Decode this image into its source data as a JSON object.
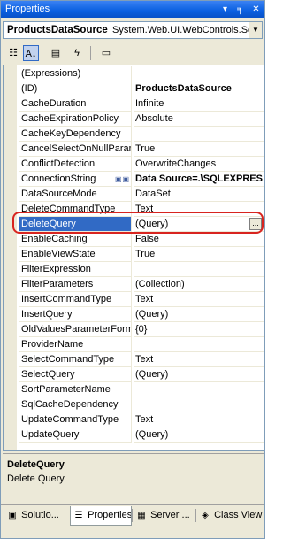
{
  "window": {
    "title": "Properties",
    "dropdown_glyph": "▾",
    "pin_glyph": "╕",
    "close_glyph": "✕"
  },
  "object_selector": {
    "name": "ProductsDataSource",
    "type": "System.Web.UI.WebControls.Sq"
  },
  "toolbar": {
    "buttons": [
      {
        "icon": "categorized-icon",
        "glyph": "☷"
      },
      {
        "icon": "alphabetical-icon",
        "glyph": "A↓"
      },
      {
        "icon": "properties-icon",
        "glyph": "▤"
      },
      {
        "icon": "events-icon",
        "glyph": "ϟ"
      },
      {
        "icon": "property-pages-icon",
        "glyph": "▭"
      }
    ]
  },
  "properties": [
    {
      "name": "(Expressions)",
      "value": ""
    },
    {
      "name": "(ID)",
      "value": "ProductsDataSource"
    },
    {
      "name": "CacheDuration",
      "value": "Infinite"
    },
    {
      "name": "CacheExpirationPolicy",
      "value": "Absolute"
    },
    {
      "name": "CacheKeyDependency",
      "value": ""
    },
    {
      "name": "CancelSelectOnNullParame",
      "value": "True"
    },
    {
      "name": "ConflictDetection",
      "value": "OverwriteChanges"
    },
    {
      "name": "ConnectionString",
      "value": "Data Source=.\\SQLEXPRES"
    },
    {
      "name": "DataSourceMode",
      "value": "DataSet"
    },
    {
      "name": "DeleteCommandType",
      "value": "Text"
    },
    {
      "name": "DeleteQuery",
      "value": "(Query)"
    },
    {
      "name": "EnableCaching",
      "value": "False"
    },
    {
      "name": "EnableViewState",
      "value": "True"
    },
    {
      "name": "FilterExpression",
      "value": ""
    },
    {
      "name": "FilterParameters",
      "value": "(Collection)"
    },
    {
      "name": "InsertCommandType",
      "value": "Text"
    },
    {
      "name": "InsertQuery",
      "value": "(Query)"
    },
    {
      "name": "OldValuesParameterForma",
      "value": "{0}"
    },
    {
      "name": "ProviderName",
      "value": ""
    },
    {
      "name": "SelectCommandType",
      "value": "Text"
    },
    {
      "name": "SelectQuery",
      "value": "(Query)"
    },
    {
      "name": "SortParameterName",
      "value": ""
    },
    {
      "name": "SqlCacheDependency",
      "value": ""
    },
    {
      "name": "UpdateCommandType",
      "value": "Text"
    },
    {
      "name": "UpdateQuery",
      "value": "(Query)"
    }
  ],
  "selected_property": "DeleteQuery",
  "ellipsis_label": "...",
  "description": {
    "title": "DeleteQuery",
    "text": "Delete Query"
  },
  "tabs": [
    {
      "label": "Solutio...",
      "icon": "solution-explorer-icon",
      "glyph": "▣"
    },
    {
      "label": "Properties",
      "icon": "properties-icon",
      "glyph": "☰"
    },
    {
      "label": "Server ...",
      "icon": "server-explorer-icon",
      "glyph": "▦"
    },
    {
      "label": "Class View",
      "icon": "class-view-icon",
      "glyph": "◈"
    }
  ],
  "active_tab": "Properties",
  "colors": {
    "title_bar": "#0a5fe0",
    "selection": "#316ac5",
    "highlight_outline": "#d8241f"
  }
}
